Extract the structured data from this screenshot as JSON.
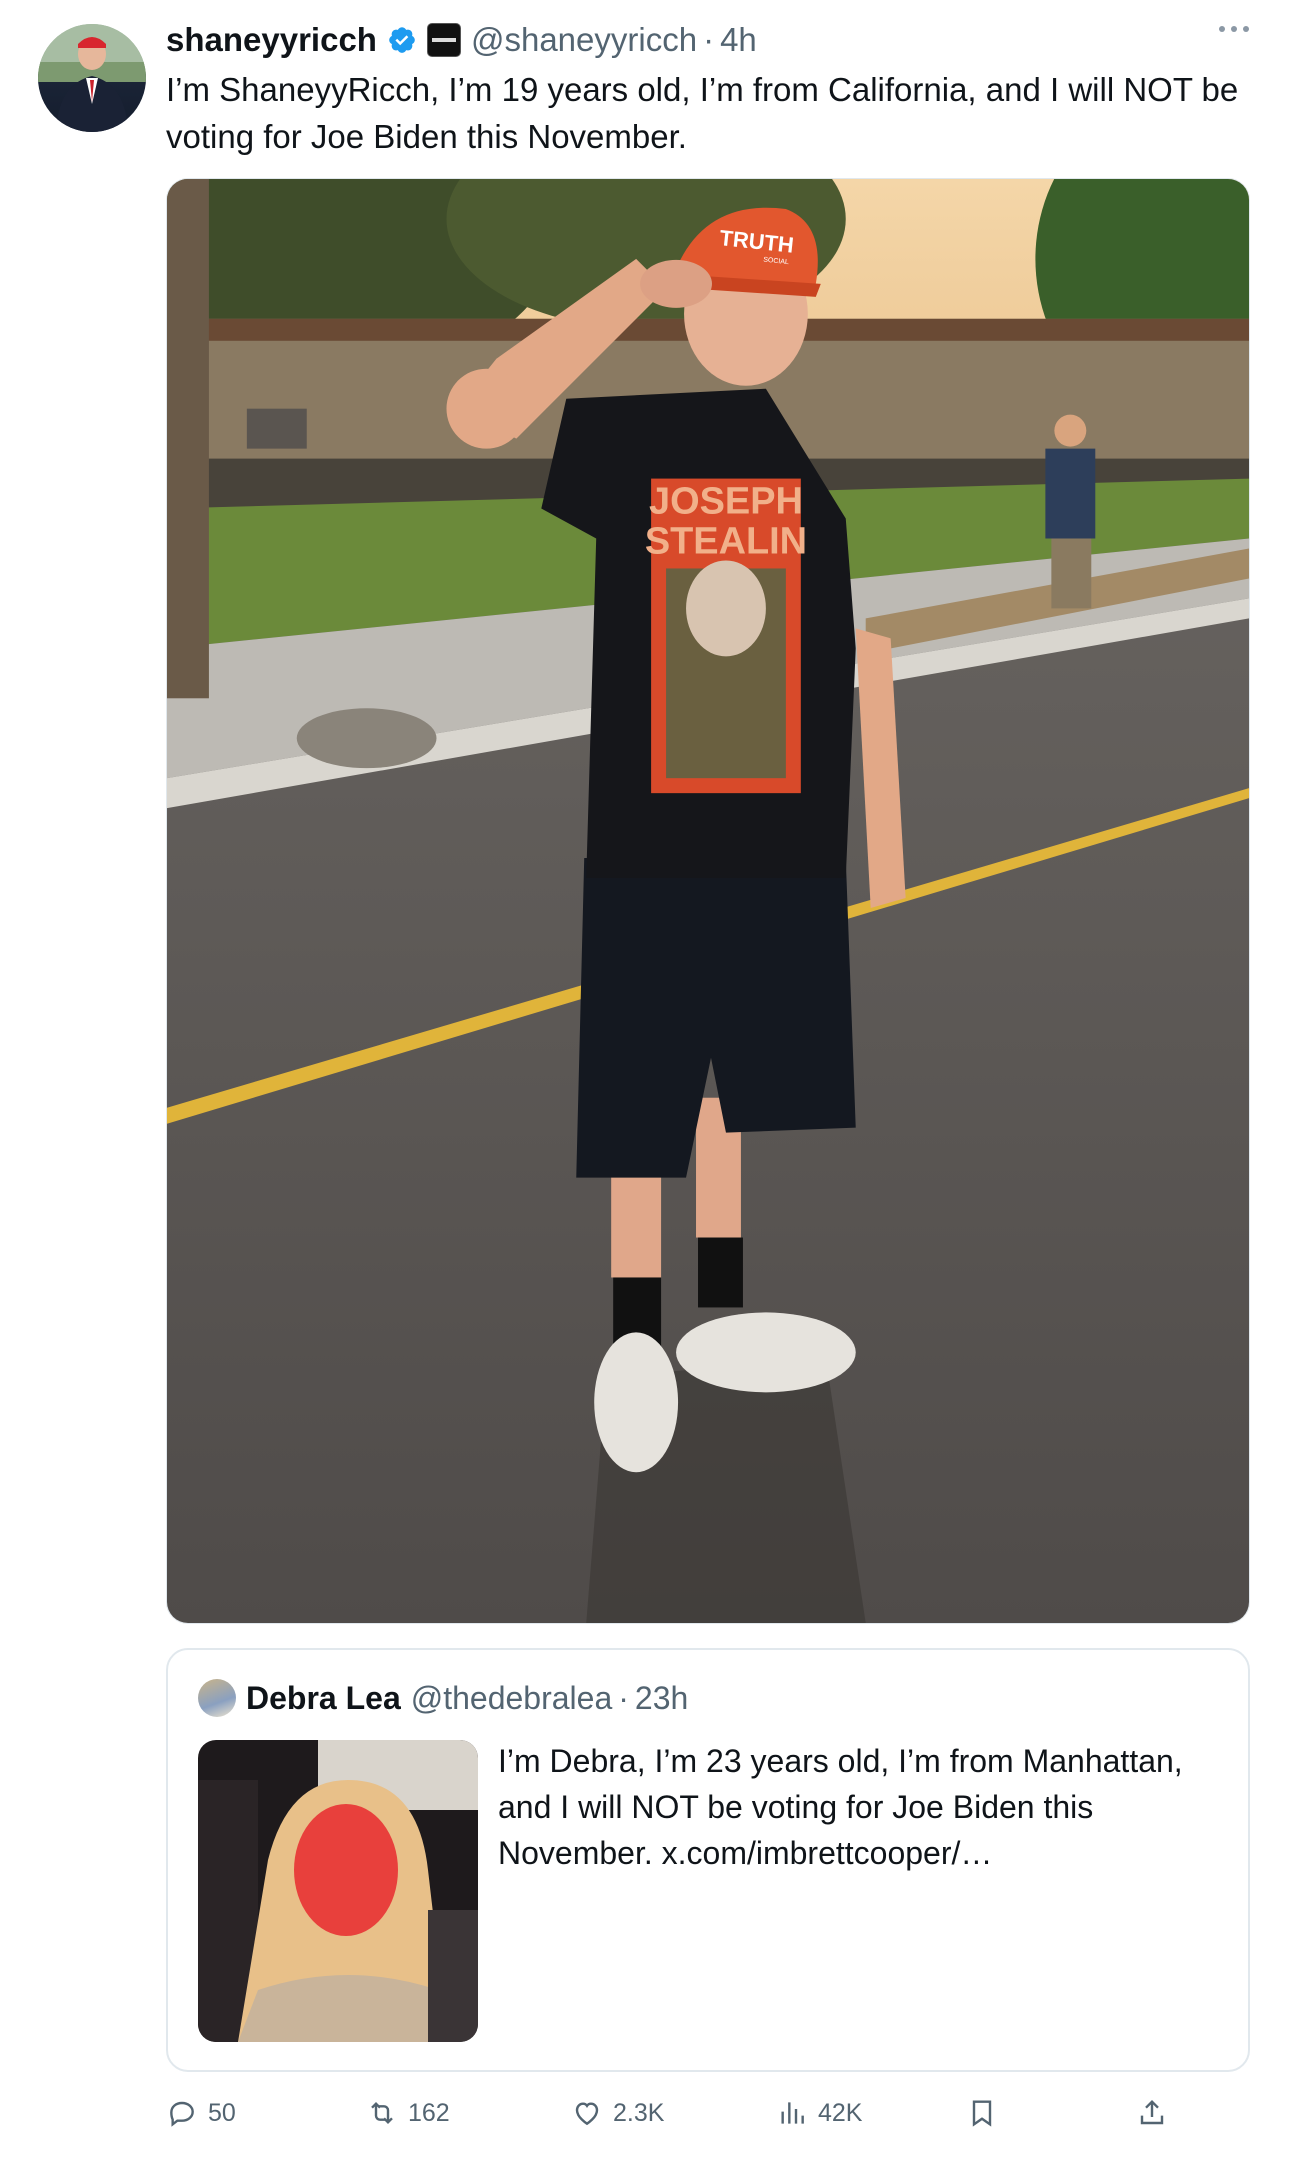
{
  "tweet": {
    "display_name": "shaneyyricch",
    "handle": "@shaneyyricch",
    "separator": "·",
    "time": "4h",
    "text": "I’m ShaneyyRicch, I’m 19 years old, I’m from California, and I will NOT be voting for Joe Biden this November.",
    "photo_text": {
      "cap": "TRUTH",
      "cap_small": "SOCIAL",
      "shirt_line1": "JOSEPH",
      "shirt_line2": "STEALIN"
    }
  },
  "quote": {
    "display_name": "Debra Lea",
    "handle": "@thedebralea",
    "separator": "·",
    "time": "23h",
    "text": "I’m Debra, I’m 23 years old, I’m from Manhattan, and I will NOT be voting for Joe Biden this November. x.com/imbrettcooper/…"
  },
  "actions": {
    "replies": "50",
    "reposts": "162",
    "likes": "2.3K",
    "views": "42K"
  },
  "icons": [
    "verified-badge-icon",
    "affiliate-badge-icon",
    "more-icon",
    "reply-icon",
    "repost-icon",
    "like-icon",
    "views-icon",
    "bookmark-icon",
    "share-icon"
  ],
  "colors": {
    "verified": "#1d9bf0",
    "text": "#0f1419",
    "secondary": "#536471",
    "border": "#e1e8ed"
  }
}
